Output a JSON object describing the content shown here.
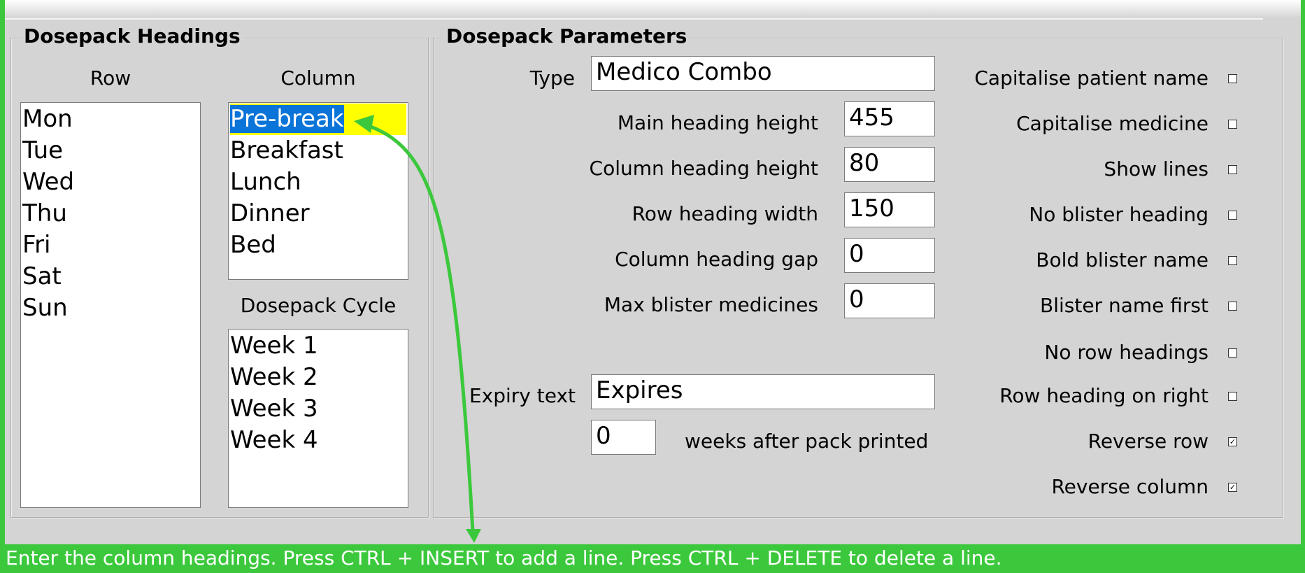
{
  "headings_panel": {
    "title": "Dosepack Headings",
    "row_label": "Row",
    "row_items": [
      "Mon",
      "Tue",
      "Wed",
      "Thu",
      "Fri",
      "Sat",
      "Sun"
    ],
    "column_label": "Column",
    "column_items": [
      "Pre-break",
      "Breakfast",
      "Lunch",
      "Dinner",
      "Bed"
    ],
    "column_selected_index": 0,
    "cycle_label": "Dosepack Cycle",
    "cycle_items": [
      "Week 1",
      "Week 2",
      "Week 3",
      "Week 4"
    ]
  },
  "params_panel": {
    "title": "Dosepack Parameters",
    "type_label": "Type",
    "type_value": "Medico Combo",
    "fields": [
      {
        "label": "Main heading height",
        "value": "455"
      },
      {
        "label": "Column heading height",
        "value": "80"
      },
      {
        "label": "Row heading width",
        "value": "150"
      },
      {
        "label": "Column heading gap",
        "value": "0"
      },
      {
        "label": "Max blister medicines",
        "value": "0"
      }
    ],
    "expiry_label": "Expiry text",
    "expiry_value": "Expires",
    "weeks_value": "0",
    "weeks_suffix": "weeks after pack printed",
    "options": [
      {
        "label": "Capitalise patient name",
        "checked": false
      },
      {
        "label": "Capitalise medicine",
        "checked": false
      },
      {
        "label": "Show lines",
        "checked": false
      },
      {
        "label": "No blister heading",
        "checked": false
      },
      {
        "label": "Bold blister name",
        "checked": false
      },
      {
        "label": "Blister name first",
        "checked": false
      },
      {
        "label": "No row headings",
        "checked": false
      },
      {
        "label": "Row heading on right",
        "checked": false
      },
      {
        "label": "Reverse row",
        "checked": true
      },
      {
        "label": "Reverse column",
        "checked": true
      }
    ]
  },
  "status_bar": {
    "text": "Enter the column headings. Press CTRL + INSERT to add a line. Press CTRL + DELETE to delete a line."
  },
  "colors": {
    "accent_green": "#3cc83c",
    "selection_blue": "#0a74d8",
    "selection_yellow": "#ffff00"
  }
}
